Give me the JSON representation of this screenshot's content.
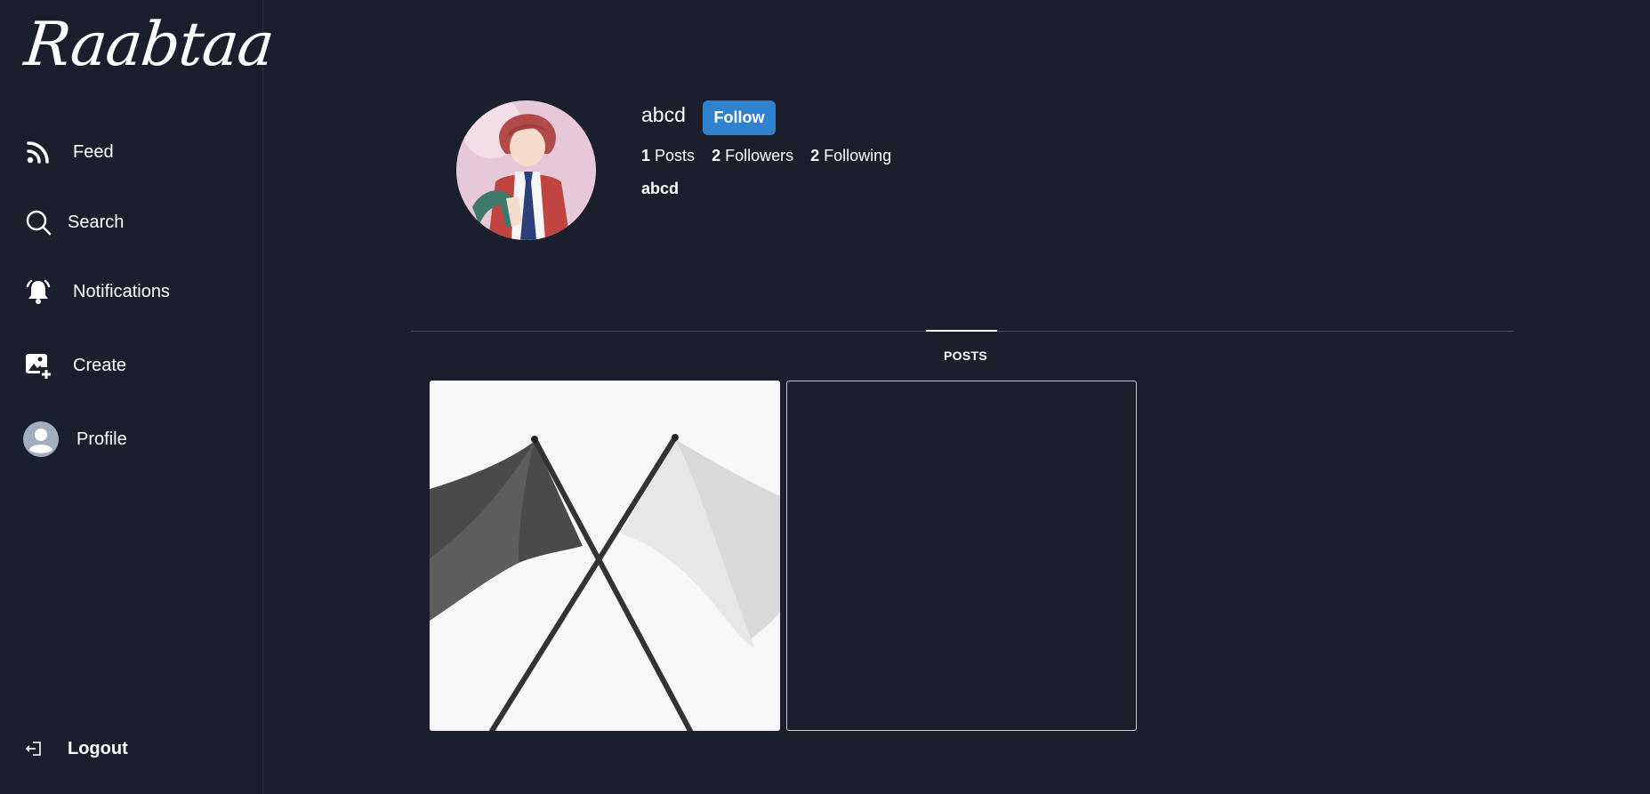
{
  "sidebar": {
    "logo": "Raabtaa",
    "items": [
      {
        "label": "Feed",
        "icon": "rss-icon"
      },
      {
        "label": "Search",
        "icon": "search-icon"
      },
      {
        "label": "Notifications",
        "icon": "bell-icon"
      },
      {
        "label": "Create",
        "icon": "add-image-icon"
      },
      {
        "label": "Profile",
        "icon": "avatar-icon"
      }
    ],
    "logout": {
      "label": "Logout",
      "icon": "logout-icon"
    }
  },
  "profile": {
    "username": "abcd",
    "follow_label": "Follow",
    "posts_count": "1",
    "posts_label": "Posts",
    "followers_count": "2",
    "followers_label": "Followers",
    "following_count": "2",
    "following_label": "Following",
    "display_name": "abcd"
  },
  "tabs": {
    "posts_label": "POSTS"
  },
  "colors": {
    "background": "#1b1f2d",
    "accent": "#3182ce",
    "text": "#ffffff"
  }
}
